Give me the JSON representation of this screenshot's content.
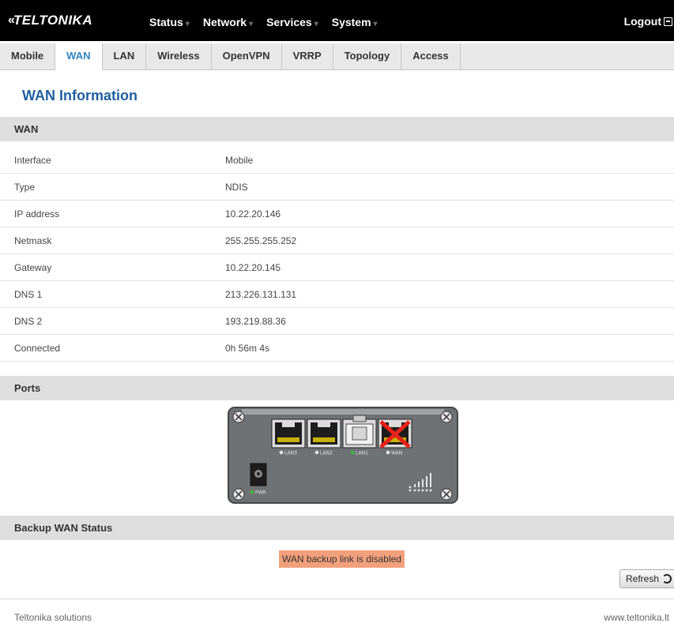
{
  "brand": {
    "name": "TELTONIKA",
    "mark": "«"
  },
  "nav": {
    "items": [
      "Status",
      "Network",
      "Services",
      "System"
    ],
    "logout": "Logout"
  },
  "tabs": [
    "Mobile",
    "WAN",
    "LAN",
    "Wireless",
    "OpenVPN",
    "VRRP",
    "Topology",
    "Access"
  ],
  "active_tab": "WAN",
  "page": {
    "title": "WAN Information"
  },
  "wan": {
    "heading": "WAN",
    "rows": [
      {
        "label": "Interface",
        "value": "Mobile"
      },
      {
        "label": "Type",
        "value": "NDIS"
      },
      {
        "label": "IP address",
        "value": "10.22.20.146"
      },
      {
        "label": "Netmask",
        "value": "255.255.255.252"
      },
      {
        "label": "Gateway",
        "value": "10.22.20.145"
      },
      {
        "label": "DNS 1",
        "value": "213.226.131.131"
      },
      {
        "label": "DNS 2",
        "value": "193.219.88.36"
      },
      {
        "label": "Connected",
        "value": "0h 56m 4s"
      }
    ]
  },
  "ports": {
    "heading": "Ports",
    "labels": [
      "LAN3",
      "LAN2",
      "LAN1",
      "WAN",
      "PWR"
    ],
    "status": {
      "LAN3": "off",
      "LAN2": "off",
      "LAN1": "on",
      "WAN": "disconnected",
      "PWR": "on"
    }
  },
  "backup": {
    "heading": "Backup WAN Status",
    "message": "WAN backup link is disabled"
  },
  "refresh_label": "Refresh",
  "footer": {
    "left": "Teltonika solutions",
    "right": "www.teltonika.lt"
  },
  "colors": {
    "accent": "#2f84c4",
    "title": "#1f5f9f",
    "warning": "#f2a07b",
    "led_on": "#3cbc3c"
  }
}
